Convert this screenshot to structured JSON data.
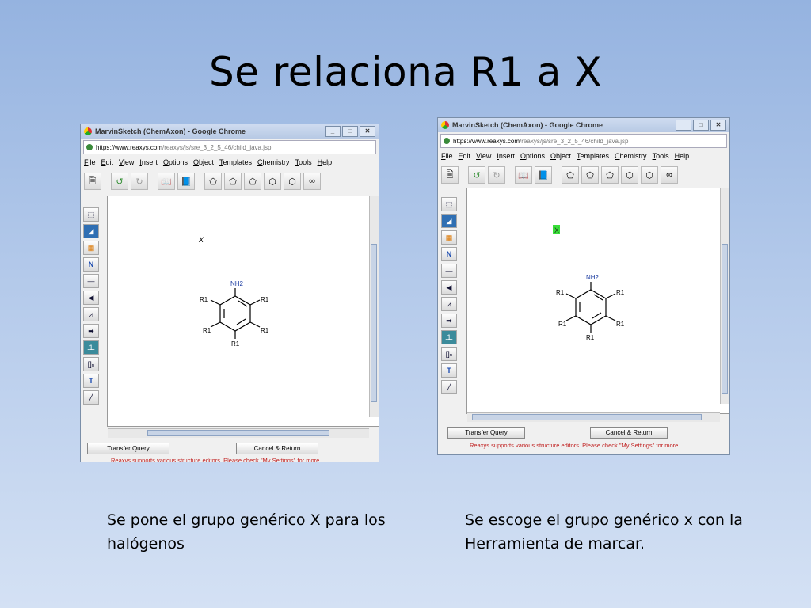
{
  "slide": {
    "title": "Se relaciona R1 a X",
    "caption_left": "Se  pone el grupo genérico X para los halógenos",
    "caption_right": "Se escoge el grupo genérico x con la Herramienta de marcar."
  },
  "window": {
    "title": "MarvinSketch (ChemAxon) - Google Chrome",
    "url_host": "https://www.reaxys.com",
    "url_path": "/reaxys/js/sre_3_2_5_46/child_java.jsp",
    "menu": [
      "File",
      "Edit",
      "View",
      "Insert",
      "Options",
      "Object",
      "Templates",
      "Chemistry",
      "Tools",
      "Help"
    ],
    "transfer_label": "Transfer Query",
    "cancel_label": "Cancel & Return",
    "footnote": "Reaxys supports various structure editors. Please check \"My Settings\" for more."
  },
  "molecule": {
    "top_group": "NH2",
    "substituent": "R1",
    "generic_group": "X"
  },
  "colors": {
    "selected_highlight": "#3adf3a",
    "footnote": "#c02020"
  }
}
